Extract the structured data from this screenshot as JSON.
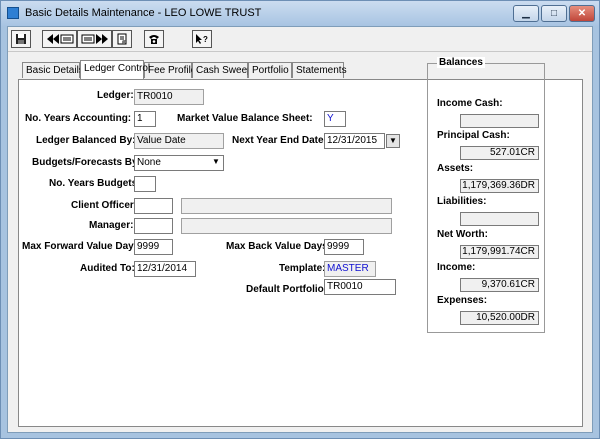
{
  "window": {
    "title": "Basic Details Maintenance - LEO LOWE TRUST",
    "controls": {
      "minimize": "▁",
      "maximize": "□",
      "close": "✕"
    }
  },
  "toolbar": {
    "icons": [
      "save-icon",
      "previous-record-icon",
      "next-record-icon",
      "report-icon",
      "phone-icon",
      "help-icon"
    ]
  },
  "tabs": [
    {
      "label": "Basic Details"
    },
    {
      "label": "Ledger Control",
      "active": true
    },
    {
      "label": "Fee Profile"
    },
    {
      "label": "Cash Sweep"
    },
    {
      "label": "Portfolio"
    },
    {
      "label": "Statements"
    }
  ],
  "form": {
    "ledger_label": "Ledger:",
    "ledger_value": "TR0010",
    "years_accounting_label": "No. Years Accounting:",
    "years_accounting_value": "1",
    "mv_balance_label": "Market Value Balance Sheet:",
    "mv_balance_value": "Y",
    "ledger_balanced_label": "Ledger Balanced By:",
    "ledger_balanced_value": "Value Date",
    "next_year_end_label": "Next Year End Date:",
    "next_year_end_value": "12/31/2015",
    "budgets_label": "Budgets/Forecasts By:",
    "budgets_value": "None",
    "years_budgets_label": "No. Years Budgets:",
    "years_budgets_value": "",
    "client_officer_label": "Client Officer:",
    "client_officer_code": "",
    "client_officer_name": "",
    "manager_label": "Manager:",
    "manager_code": "",
    "manager_name": "",
    "max_forward_label": "Max Forward Value Days:",
    "max_forward_value": "9999",
    "max_back_label": "Max Back Value Days:",
    "max_back_value": "9999",
    "audited_to_label": "Audited To:",
    "audited_to_value": "12/31/2014",
    "template_label": "Template:",
    "template_value": "MASTER",
    "default_portfolio_label": "Default Portfolio:",
    "default_portfolio_value": "TR0010"
  },
  "balances": {
    "title": "Balances",
    "items": [
      {
        "label": "Income Cash:",
        "value": ""
      },
      {
        "label": "Principal Cash:",
        "value": "527.01CR"
      },
      {
        "label": "Assets:",
        "value": "1,179,369.36DR"
      },
      {
        "label": "Liabilities:",
        "value": ""
      },
      {
        "label": "Net Worth:",
        "value": "1,179,991.74CR"
      },
      {
        "label": "Income:",
        "value": "9,370.61CR"
      },
      {
        "label": "Expenses:",
        "value": "10,520.00DR"
      }
    ]
  },
  "colors": {
    "frame": "#a7c3e0",
    "blue_text": "#1010d0"
  }
}
